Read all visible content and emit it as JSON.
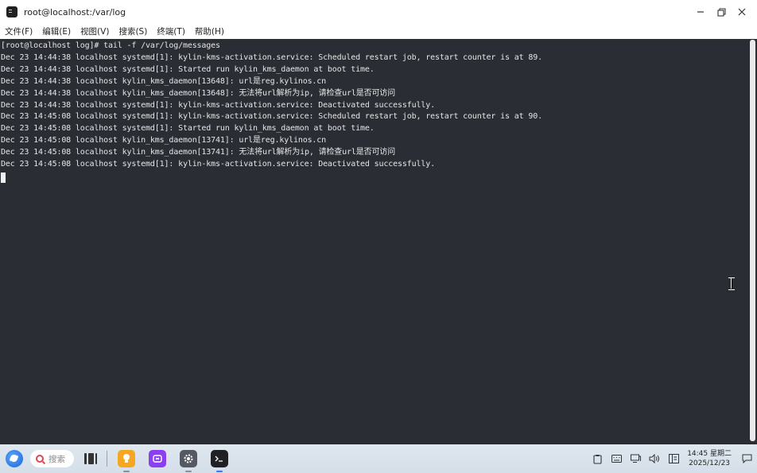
{
  "window": {
    "title": "root@localhost:/var/log",
    "icon": "terminal-icon",
    "controls": {
      "minimize": "–",
      "restore": "❐",
      "close": "✕"
    }
  },
  "menubar": {
    "items": [
      {
        "label": "文件(F)"
      },
      {
        "label": "编辑(E)"
      },
      {
        "label": "视图(V)"
      },
      {
        "label": "搜索(S)"
      },
      {
        "label": "终端(T)"
      },
      {
        "label": "帮助(H)"
      }
    ]
  },
  "terminal": {
    "lines": [
      "[root@localhost log]# tail -f /var/log/messages",
      "Dec 23 14:44:38 localhost systemd[1]: kylin-kms-activation.service: Scheduled restart job, restart counter is at 89.",
      "Dec 23 14:44:38 localhost systemd[1]: Started run kylin_kms_daemon at boot time.",
      "Dec 23 14:44:38 localhost kylin_kms_daemon[13648]: url是reg.kylinos.cn",
      "Dec 23 14:44:38 localhost kylin_kms_daemon[13648]: 无法将url解析为ip, 请检查url是否可访问",
      "Dec 23 14:44:38 localhost systemd[1]: kylin-kms-activation.service: Deactivated successfully.",
      "Dec 23 14:45:08 localhost systemd[1]: kylin-kms-activation.service: Scheduled restart job, restart counter is at 90.",
      "Dec 23 14:45:08 localhost systemd[1]: Started run kylin_kms_daemon at boot time.",
      "Dec 23 14:45:08 localhost kylin_kms_daemon[13741]: url是reg.kylinos.cn",
      "Dec 23 14:45:08 localhost kylin_kms_daemon[13741]: 无法将url解析为ip, 请检查url是否可访问",
      "Dec 23 14:45:08 localhost systemd[1]: kylin-kms-activation.service: Deactivated successfully."
    ],
    "colors": {
      "background": "#2a2d34",
      "foreground": "#e6e6e6"
    }
  },
  "taskbar": {
    "search_placeholder": "搜索",
    "apps": [
      {
        "name": "idea-bulb-app-icon",
        "color": "#f5a623"
      },
      {
        "name": "software-center-icon",
        "color": "#8a3ff0"
      },
      {
        "name": "settings-gear-icon",
        "color": "#555a62"
      },
      {
        "name": "terminal-app-icon",
        "color": "#1f2125"
      }
    ],
    "clock": {
      "time": "14:45 星期二",
      "date": "2025/12/23"
    }
  }
}
